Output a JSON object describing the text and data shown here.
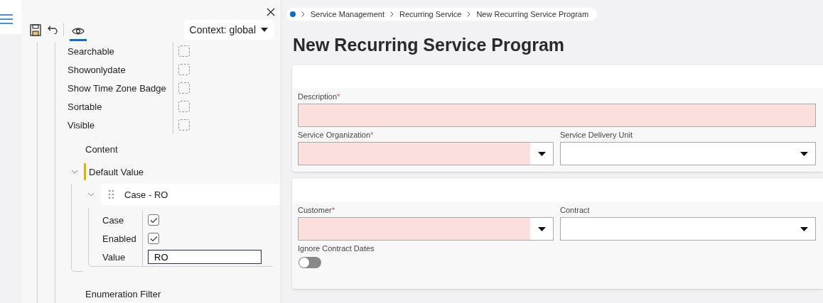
{
  "panel": {
    "preview_active": true,
    "context_dropdown": "Context: global",
    "properties": [
      {
        "label": "Searchable",
        "checked": false
      },
      {
        "label": "Showonlydate",
        "checked": false
      },
      {
        "label": "Show Time Zone Badge",
        "checked": false
      },
      {
        "label": "Sortable",
        "checked": false
      },
      {
        "label": "Visible",
        "checked": false
      }
    ],
    "content_label": "Content",
    "default_value": {
      "label": "Default Value",
      "expanded": true,
      "items": [
        {
          "title": "Case - RO",
          "expanded": true,
          "fields": [
            {
              "kind": "checkbox",
              "label": "Case",
              "checked": true
            },
            {
              "kind": "checkbox",
              "label": "Enabled",
              "checked": true
            },
            {
              "kind": "text",
              "label": "Value",
              "value": "RO"
            }
          ]
        }
      ]
    },
    "next_label": "Enumeration Filter"
  },
  "breadcrumb": [
    "Service Management",
    "Recurring Service",
    "New Recurring Service Program"
  ],
  "title": "New Recurring Service Program",
  "required_mark": "*",
  "cards": [
    {
      "rows": [
        [
          {
            "kind": "text",
            "label": "Description",
            "required": true
          }
        ],
        [
          {
            "kind": "select",
            "label": "Service Organization",
            "required": true
          },
          {
            "kind": "select",
            "label": "Service Delivery Unit",
            "required": false
          }
        ]
      ]
    },
    {
      "rows": [
        [
          {
            "kind": "select",
            "label": "Customer",
            "required": true
          },
          {
            "kind": "select",
            "label": "Contract",
            "required": false
          }
        ],
        [
          {
            "kind": "toggle",
            "label": "Ignore Contract Dates",
            "on": false
          }
        ]
      ]
    }
  ]
}
